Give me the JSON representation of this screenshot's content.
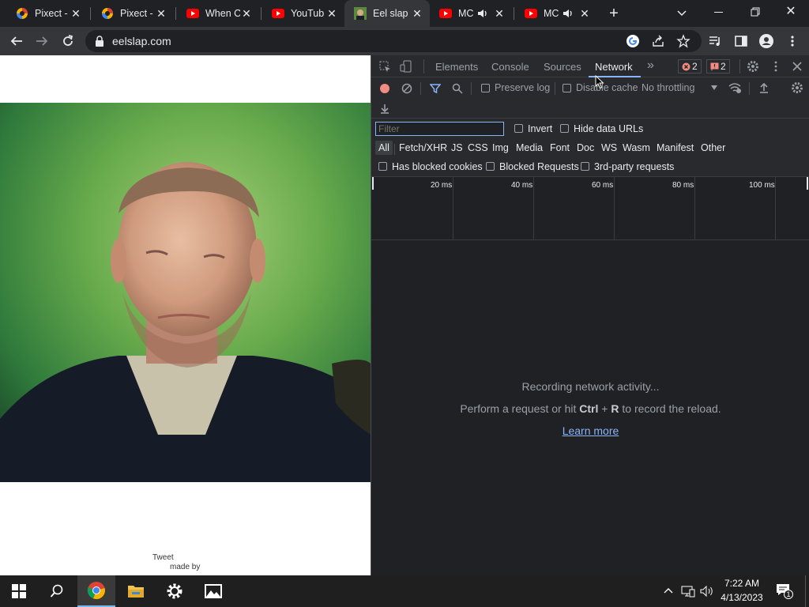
{
  "browser": {
    "tabs": [
      {
        "title": "Pixect -",
        "icon": "pixect-icon"
      },
      {
        "title": "Pixect -",
        "icon": "pixect-icon"
      },
      {
        "title": "When C",
        "icon": "youtube-icon"
      },
      {
        "title": "YouTub",
        "icon": "youtube-icon"
      },
      {
        "title": "Eel slap",
        "icon": "eelslap-icon",
        "active": true
      },
      {
        "title": "MC",
        "icon": "youtube-icon",
        "audio": true
      },
      {
        "title": "MC",
        "icon": "youtube-icon",
        "audio": true
      }
    ],
    "new_tab_label": "+",
    "url": "eelslap.com"
  },
  "page": {
    "tweet_label": "Tweet",
    "made_by_label": "made by"
  },
  "devtools": {
    "tabs": [
      "Elements",
      "Console",
      "Sources",
      "Network"
    ],
    "active_tab": "Network",
    "more_tabs_label": "»",
    "error_count": "2",
    "issue_count": "2",
    "toolbar": {
      "preserve_log_label": "Preserve log",
      "disable_cache_label": "Disable cache",
      "throttling_value": "No throttling"
    },
    "filter": {
      "placeholder": "Filter",
      "invert_label": "Invert",
      "hide_data_urls_label": "Hide data URLs",
      "types": [
        "All",
        "Fetch/XHR",
        "JS",
        "CSS",
        "Img",
        "Media",
        "Font",
        "Doc",
        "WS",
        "Wasm",
        "Manifest",
        "Other"
      ],
      "has_blocked_cookies_label": "Has blocked cookies",
      "blocked_requests_label": "Blocked Requests",
      "third_party_label": "3rd-party requests"
    },
    "timeline_ticks": [
      "20 ms",
      "40 ms",
      "60 ms",
      "80 ms",
      "100 ms"
    ],
    "empty": {
      "line1": "Recording network activity...",
      "line2_prefix": "Perform a request or hit ",
      "line2_key1": "Ctrl",
      "line2_plus": " + ",
      "line2_key2": "R",
      "line2_suffix": " to record the reload.",
      "learn_more": "Learn more"
    }
  },
  "taskbar": {
    "time": "7:22 AM",
    "date": "4/13/2023",
    "notification_count": "1"
  },
  "colors": {
    "accent_blue": "#8ab4f8",
    "record_red": "#f28b82",
    "youtube_red": "#ff0000"
  }
}
